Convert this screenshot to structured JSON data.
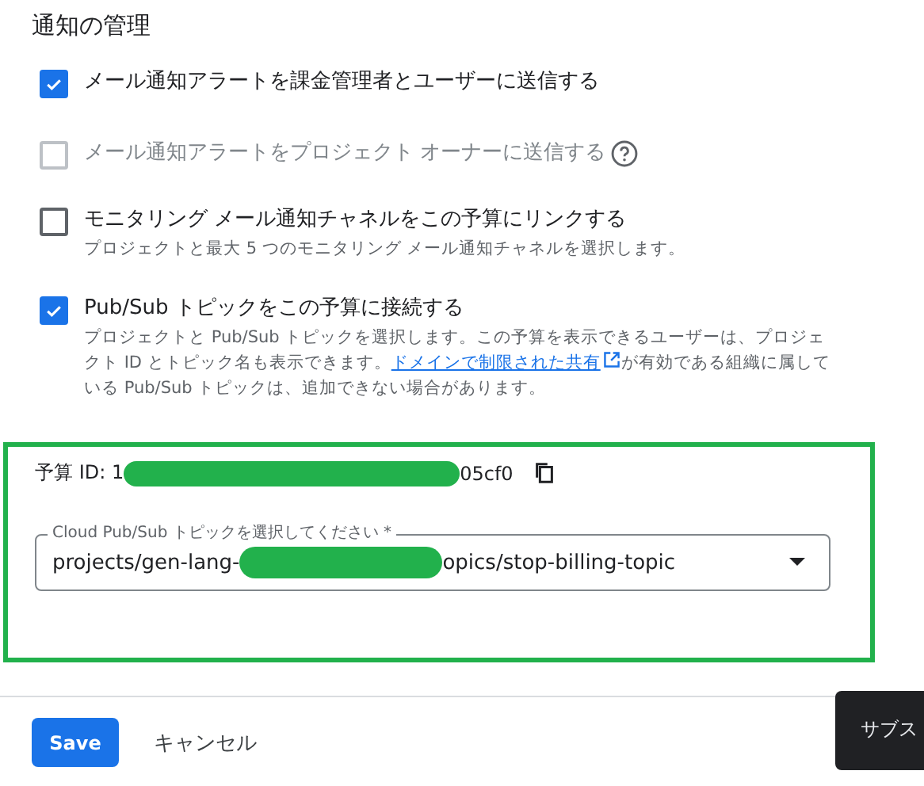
{
  "section_title": "通知の管理",
  "options": [
    {
      "label": "メール通知アラートを課金管理者とユーザーに送信する",
      "checked": true,
      "disabled": false,
      "help": false
    },
    {
      "label": "メール通知アラートをプロジェクト オーナーに送信する",
      "checked": false,
      "disabled": true,
      "help": true
    },
    {
      "label": "モニタリング メール通知チャネルをこの予算にリンクする",
      "checked": false,
      "disabled": false,
      "help": false,
      "description": "プロジェクトと最大 5 つのモニタリング メール通知チャネルを選択します。"
    },
    {
      "label": "Pub/Sub トピックをこの予算に接続する",
      "checked": true,
      "disabled": false,
      "help": false,
      "description": "プロジェクトと Pub/Sub トピックを選択します。この予算を表示できるユーザーは、プロジェクト ID とトピック名も表示できます。",
      "link": "ドメインで制限された共有",
      "description_after": "が有効である組織に属している Pub/Sub トピックは、追加できない場合があります。"
    }
  ],
  "budget_id": {
    "label": "予算 ID: 1",
    "suffix": "05cf0"
  },
  "topic_field": {
    "label": "Cloud Pub/Sub トピックを選択してください *",
    "value_start": "projects/gen-lang-",
    "value_end": "opics/stop-billing-topic"
  },
  "buttons": [
    {
      "label": "Save",
      "kind": "primary"
    },
    {
      "label": "キャンセル",
      "kind": "text"
    }
  ],
  "toast": {
    "text": "サブス"
  }
}
